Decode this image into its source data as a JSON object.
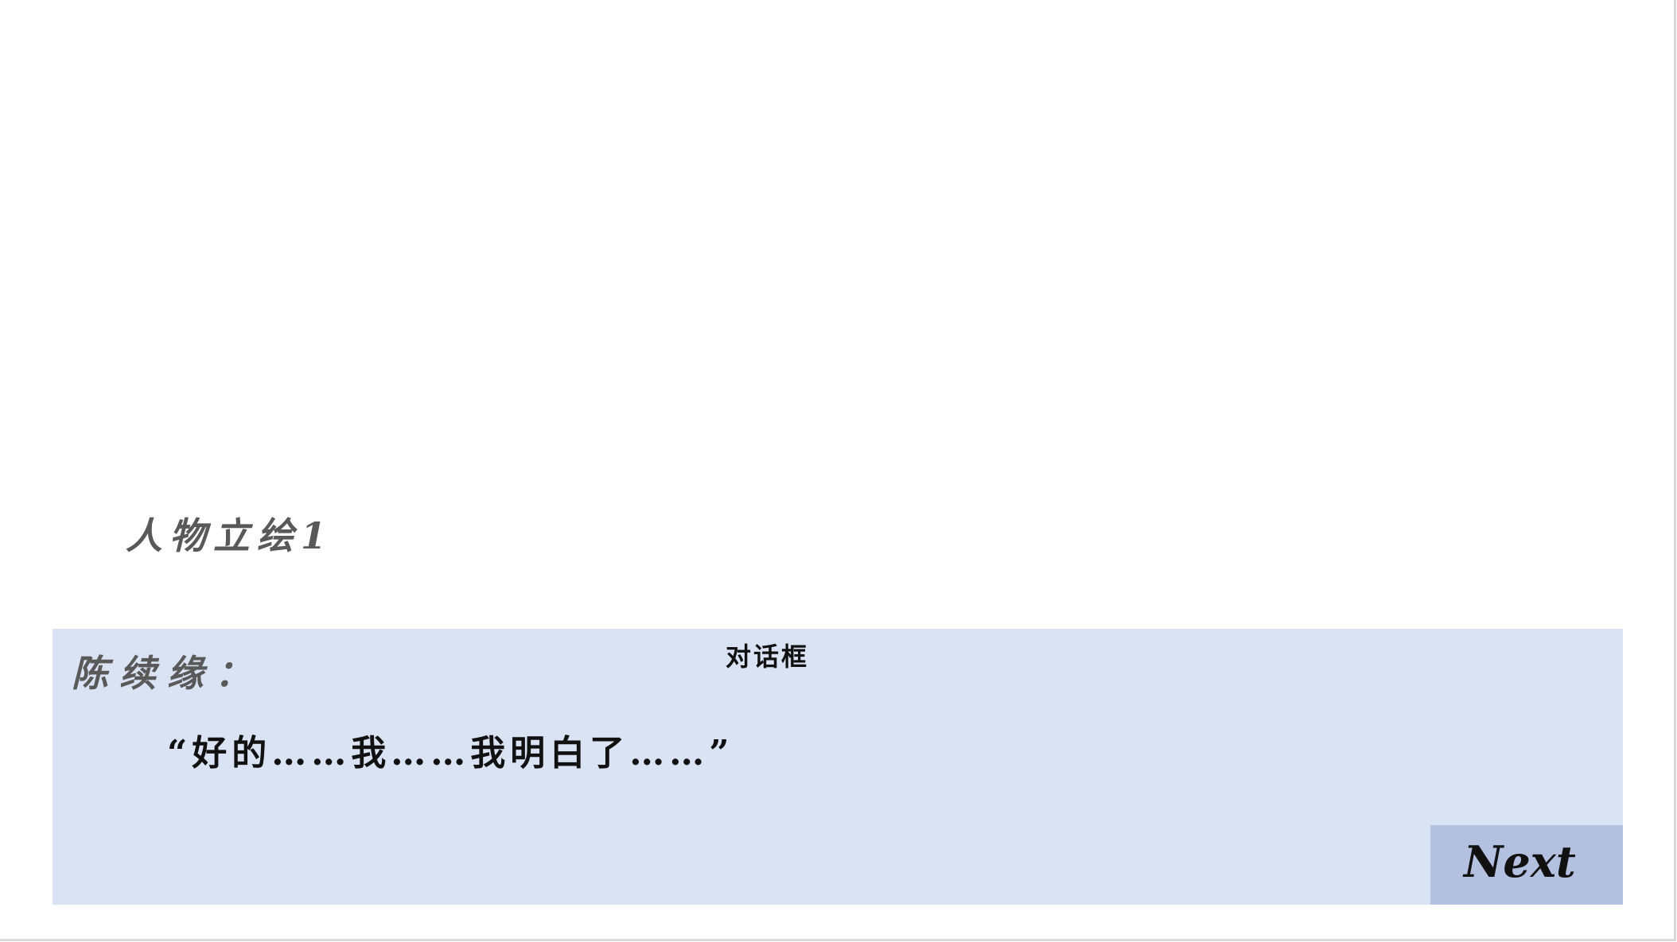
{
  "scene": {
    "character_sprite_label": "人物立绘1"
  },
  "dialogue": {
    "box_label": "对话框",
    "speaker": "陈续缘：",
    "line": "“好的……我……我明白了……”"
  },
  "controls": {
    "next_label": "Next"
  },
  "colors": {
    "dialogue_background": "#dae3f3",
    "next_button_background": "#b4c0e0",
    "muted_text": "#595959",
    "primary_text": "#111111"
  }
}
